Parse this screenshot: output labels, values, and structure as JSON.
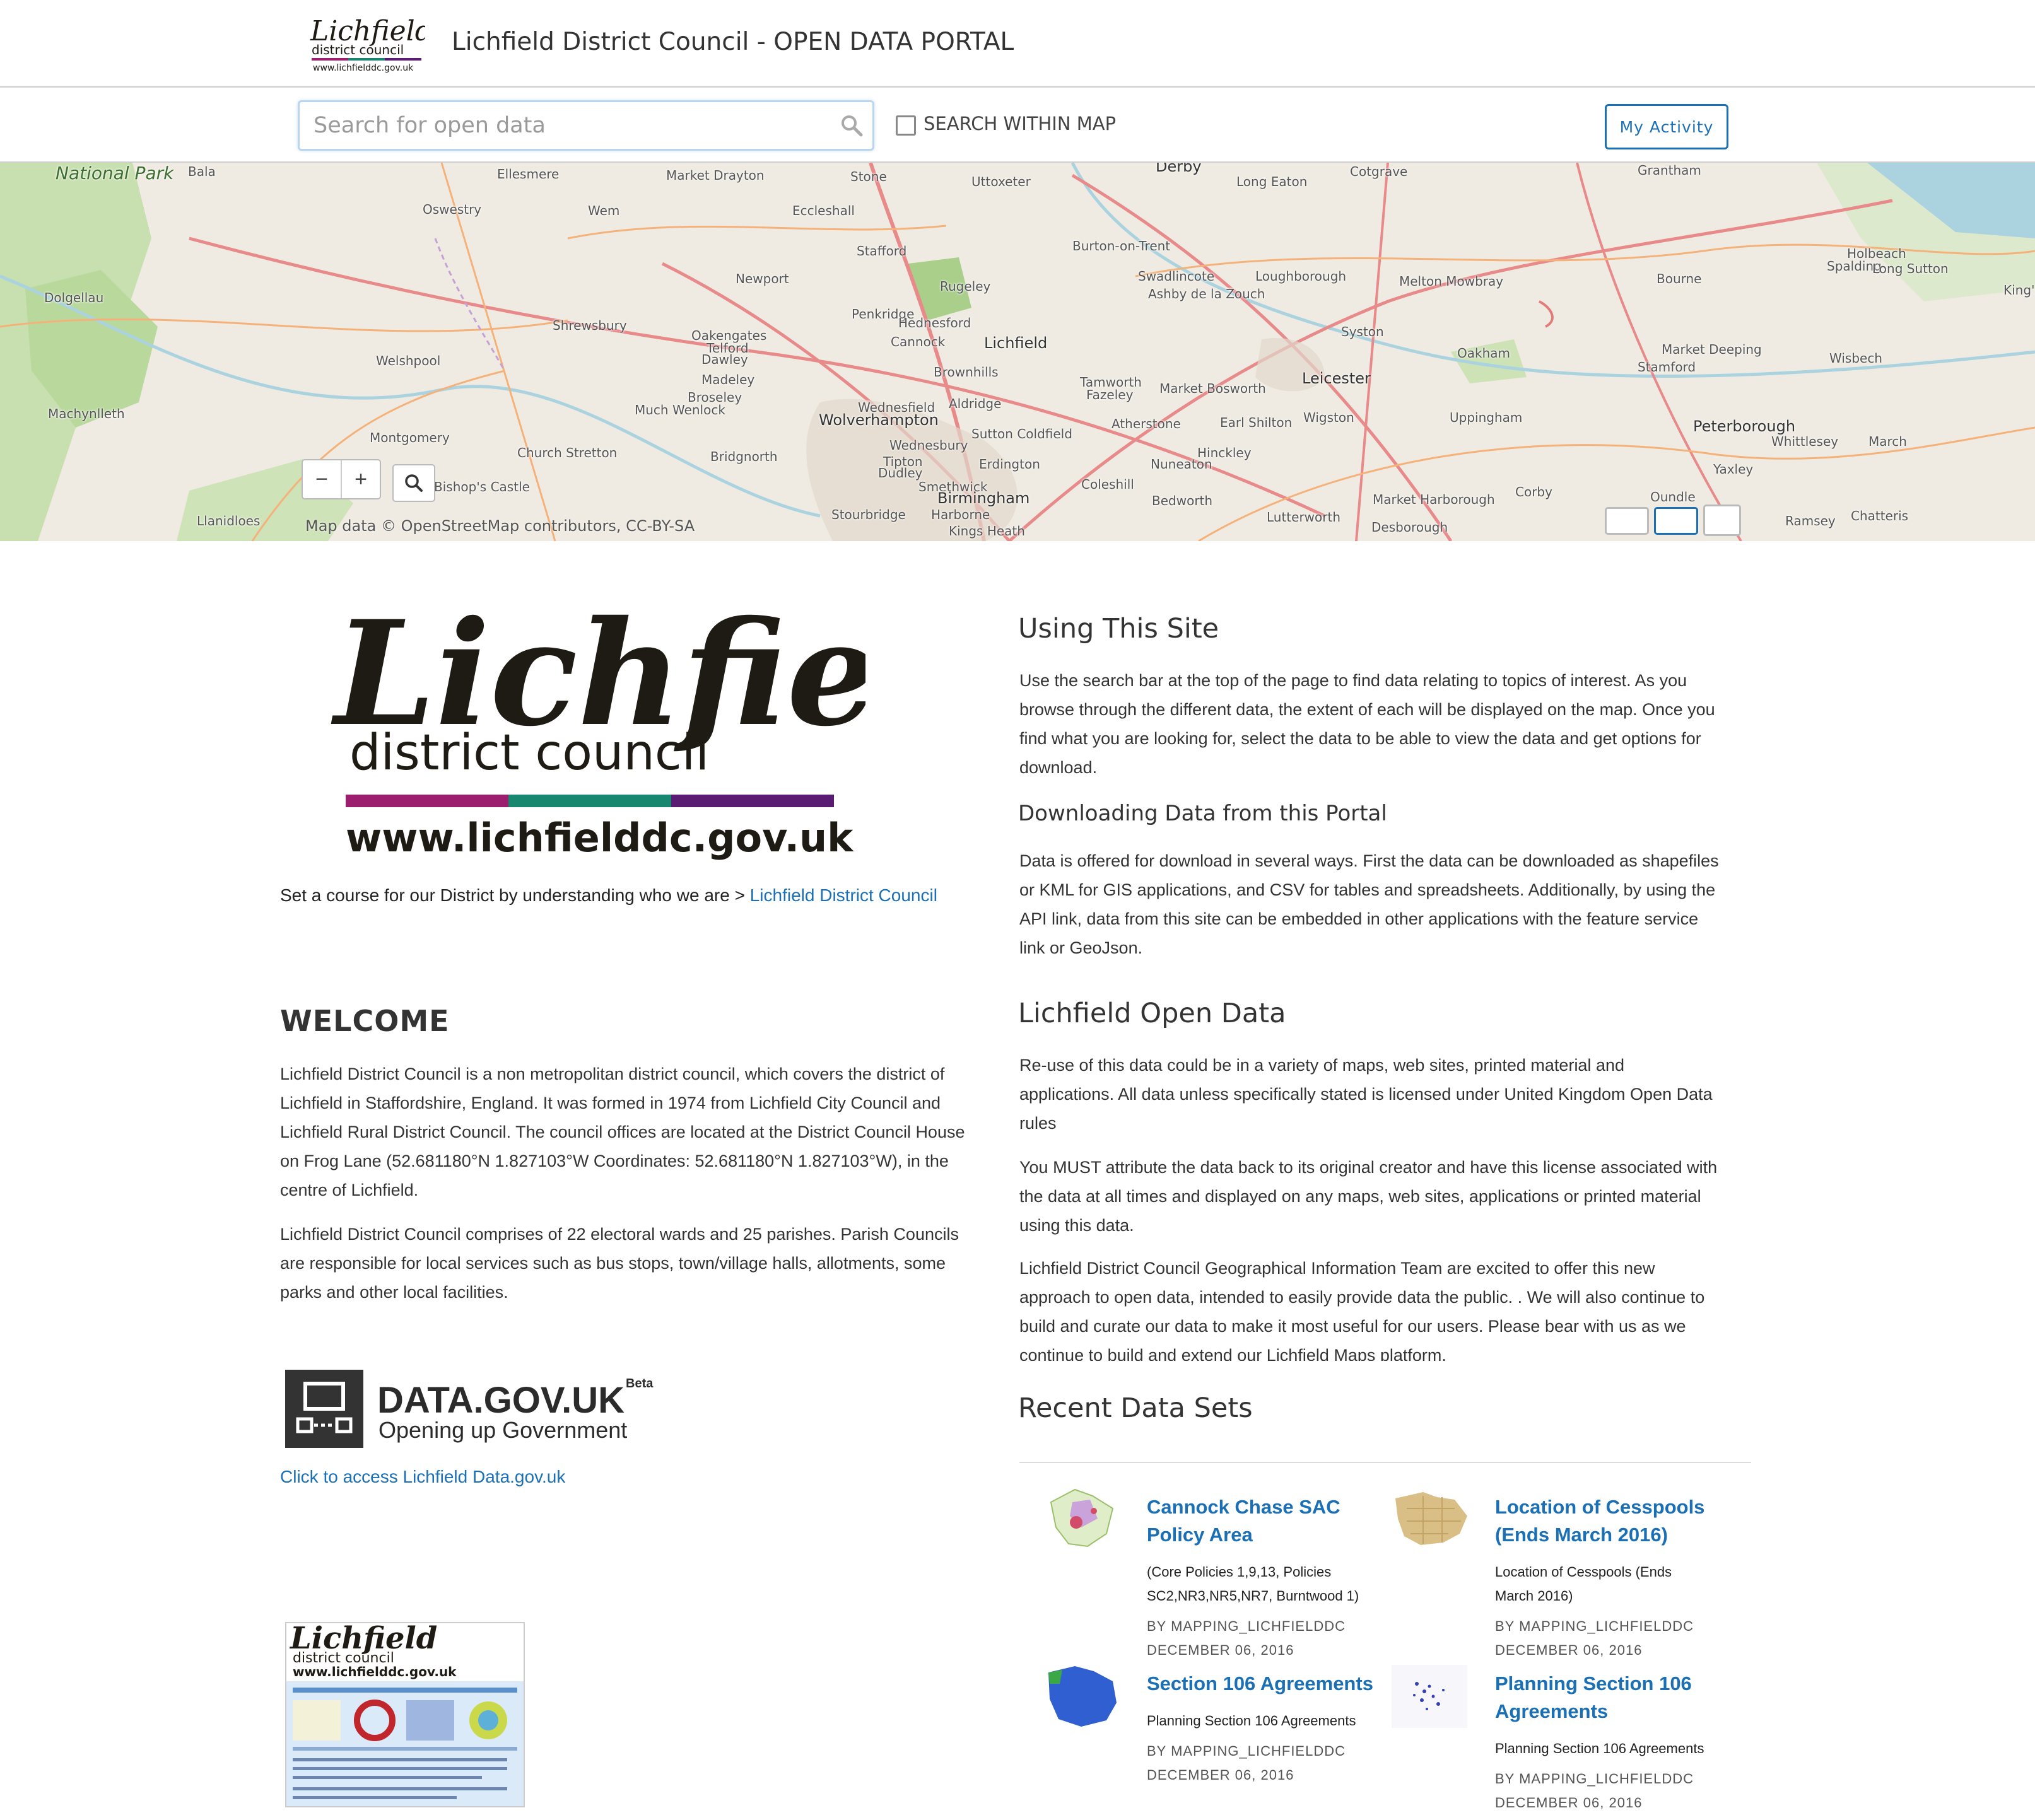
{
  "header": {
    "logo_alt": "Lichfield district council www.lichfielddc.gov.uk",
    "title": "Lichfield District Council - OPEN DATA PORTAL"
  },
  "search": {
    "placeholder": "Search for open data",
    "within_map_label": "SEARCH WITHIN MAP",
    "my_activity_label": "My Activity"
  },
  "map": {
    "attribution": "Map data © OpenStreetMap contributors, CC-BY-SA",
    "zoom_out": "−",
    "zoom_in": "+",
    "places": [
      "National Park",
      "Bala",
      "Ellesmere",
      "Market Drayton",
      "Stone",
      "Uttoxeter",
      "Derby",
      "Long Eaton",
      "Cotgrave",
      "Grantham",
      "Oswestry",
      "Wem",
      "Eccleshall",
      "Stafford",
      "Burton-on-Trent",
      "Swadlincote",
      "Loughborough",
      "Melton Mowbray",
      "Bourne",
      "Spalding",
      "Holbeach",
      "Long Sutton",
      "Dolgellau",
      "Newport",
      "Rugeley",
      "Ashby de la Zouch",
      "Penkridge",
      "Hednesford",
      "Syston",
      "Welshpool",
      "Shrewsbury",
      "Oakengates",
      "Telford",
      "Dawley",
      "Cannock",
      "Lichfield",
      "Oakham",
      "Market Deeping",
      "Wisbech",
      "Madeley",
      "Brownhills",
      "Leicester",
      "Stamford",
      "Machynlleth",
      "Broseley",
      "Much Wenlock",
      "Wednesfield",
      "Aldridge",
      "Tamworth",
      "Fazeley",
      "Market Bosworth",
      "Wigston",
      "Uppingham",
      "Peterborough",
      "Wolverhampton",
      "Sutton Coldfield",
      "Atherstone",
      "Earl Shilton",
      "Whittlesey",
      "March",
      "Montgomery",
      "Church Stretton",
      "Bridgnorth",
      "Wednesbury",
      "Tipton",
      "Dudley",
      "Erdington",
      "Nuneaton",
      "Hinckley",
      "Yaxley",
      "Bishop's Castle",
      "Smethwick",
      "Coleshill",
      "Birmingham",
      "Bedworth",
      "Market Harborough",
      "Corby",
      "Oundle",
      "Llanidloes",
      "Stourbridge",
      "Harborne",
      "Kings Heath",
      "Lutterworth",
      "Desborough",
      "Ramsey",
      "Chatteris",
      "King's"
    ],
    "colors": {
      "land": "#efebe2",
      "water": "#aad3df",
      "green": "#b9d99c",
      "road_major": "#e8898a",
      "road_minor": "#f4b27a"
    }
  },
  "left": {
    "big_logo": {
      "script": "Lichfield",
      "line2": "district council",
      "url": "www.lichfielddc.gov.uk"
    },
    "course_text": "Set a course for our District by understanding who we are > ",
    "course_link": "Lichfield District Council",
    "welcome_heading": "WELCOME",
    "welcome_p1_lines": [
      "Lichfield District Council is a non metropolitan district council, which covers the district of",
      "Lichfield in Staffordshire, England. It was formed in 1974 from Lichfield City Council and",
      "Lichfield Rural District Council. The council offices are located at the District Council House",
      "on Frog Lane (52.681180°N 1.827103°W Coordinates: 52.681180°N 1.827103°W), in the",
      "centre of Lichfield."
    ],
    "welcome_p2_lines": [
      "Lichfield District Council comprises of 22 electoral wards and 25 parishes. Parish Councils",
      "are responsible for local services such as bus stops, town/village halls, allotments, some",
      "parks and other local facilities."
    ],
    "datagov": {
      "name": "DATA.GOV.UK",
      "badge": "Beta",
      "tagline": "Opening up Government"
    },
    "datagov_link": "Click to access Lichfield Data.gov.uk",
    "thumb_logo": {
      "script": "Lichfield",
      "line2": "district council",
      "url": "www.lichfielddc.gov.uk"
    }
  },
  "right": {
    "using_heading": "Using This Site",
    "using_lines": [
      "Use the search bar at the top of the page to find data relating to topics of interest. As you",
      "browse through the different data, the extent of each will be displayed on the map. Once you",
      "find what you are looking for, select the data to be able to view the data and get options for",
      "download."
    ],
    "downloading_heading": "Downloading Data from this Portal",
    "downloading_lines": [
      "Data is offered for download in several ways. First the data can be downloaded as shapefiles",
      "or KML for GIS applications, and CSV for tables and spreadsheets. Additionally, by using the",
      "API link, data from this site can be embedded in other applications with the feature service",
      "link or GeoJson."
    ],
    "open_data_heading": "Lichfield Open Data",
    "open_p1_lines": [
      "Re-use of this data could be in a variety of maps, web sites, printed material and",
      "applications. All data unless specifically stated is licensed under United Kingdom Open Data",
      "rules"
    ],
    "open_p2_lines": [
      "You MUST attribute the data back to its original creator and have this license associated with",
      "the data at all times and displayed on any maps, web sites, applications or printed material",
      "using this data."
    ],
    "open_p3_lines": [
      "Lichfield District Council Geographical Information Team are excited to offer this new",
      "approach to open data, intended to easily provide data the public. . We will also continue to",
      "build and curate our data to make it most useful for our users. Please bear with us as we",
      "continue to build and extend our Lichfield Maps platform."
    ],
    "recent_heading": "Recent Data Sets",
    "datasets": [
      {
        "title_lines": [
          "Cannock Chase SAC",
          "Policy Area"
        ],
        "desc_lines": [
          "(Core Policies 1,9,13, Policies",
          "SC2,NR3,NR5,NR7, Burntwood 1)"
        ],
        "owner": "BY MAPPING_LICHFIELDDC",
        "date": "DECEMBER 06, 2016"
      },
      {
        "title_lines": [
          "Location of Cesspools",
          "(Ends March 2016)"
        ],
        "desc_lines": [
          "Location of Cesspools (Ends",
          "March 2016)"
        ],
        "owner": "BY MAPPING_LICHFIELDDC",
        "date": "DECEMBER 06, 2016"
      },
      {
        "title_lines": [
          "Section 106 Agreements"
        ],
        "desc_lines": [
          "Planning Section 106 Agreements"
        ],
        "owner": "BY MAPPING_LICHFIELDDC",
        "date": "DECEMBER 06, 2016"
      },
      {
        "title_lines": [
          "Planning Section 106",
          "Agreements"
        ],
        "desc_lines": [
          "Planning Section 106 Agreements"
        ],
        "owner": "BY MAPPING_LICHFIELDDC",
        "date": "DECEMBER 06, 2016"
      }
    ]
  }
}
